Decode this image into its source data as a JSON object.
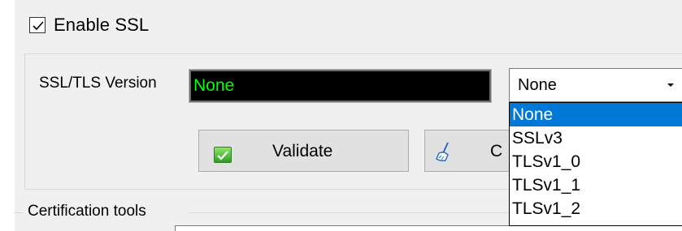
{
  "ssl": {
    "enable_label": "Enable SSL",
    "enabled": true,
    "version_label": "SSL/TLS Version",
    "version_display_value": "None",
    "version_display_color": "#00ff00",
    "select_value": "None",
    "options": [
      "None",
      "SSLv3",
      "TLSv1_0",
      "TLSv1_1",
      "TLSv1_2"
    ],
    "selected_option": "None",
    "selection_color": "#0078d7"
  },
  "buttons": {
    "validate_label": "Validate",
    "clear_label_visible": "C"
  },
  "certification": {
    "group_title": "Certification tools"
  },
  "icons": {
    "checkbox": "checkmark-icon",
    "dropdown_arrow": "chevron-down-icon",
    "validate": "green-check-icon",
    "clear": "broom-icon"
  }
}
